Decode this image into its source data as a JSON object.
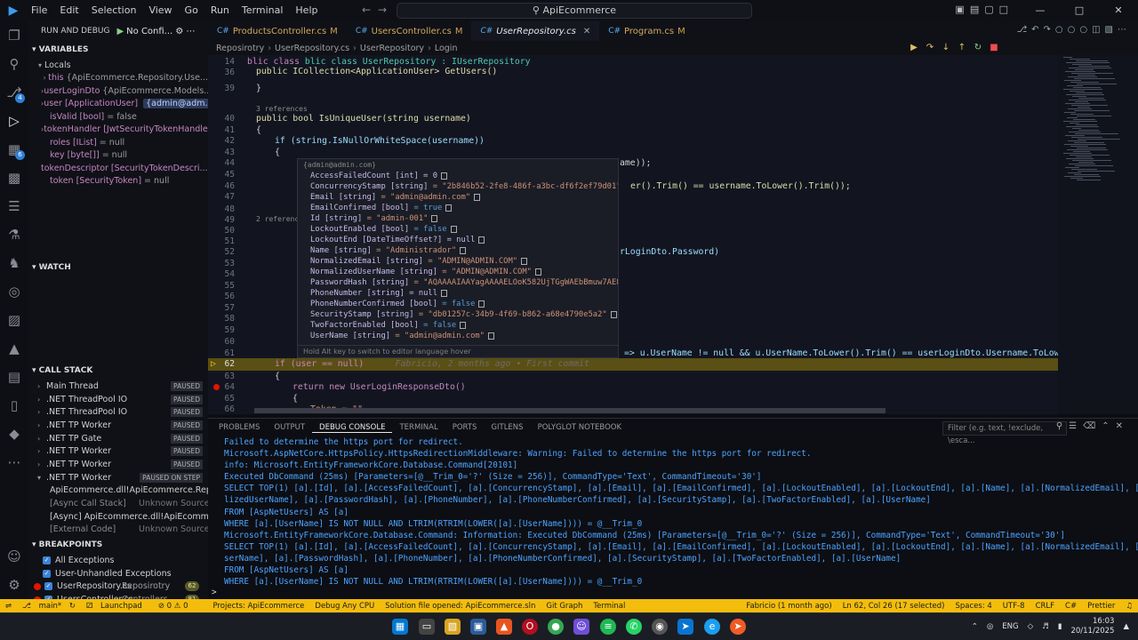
{
  "titlebar": {
    "menu": [
      "File",
      "Edit",
      "Selection",
      "View",
      "Go",
      "Run",
      "Terminal",
      "Help"
    ],
    "search": "ApiEcommerce"
  },
  "debug": {
    "header": "RUN AND DEBUG",
    "config": "No Confi...",
    "variables_title": "VARIABLES",
    "locals_title": "Locals",
    "locals": [
      {
        "name": "this",
        "value": "{ApiEcommerce.Repository.Use..."
      },
      {
        "name": "userLoginDto",
        "value": "{ApiEcommerce.Models..."
      },
      {
        "name": "user [ApplicationUser]",
        "value": "",
        "pill": "{admin@adm..."
      },
      {
        "name": "isValid [bool]",
        "value": "= false"
      },
      {
        "name": "tokenHandler [JwtSecurityTokenHandler...",
        "value": ""
      },
      {
        "name": "roles [IList]",
        "value": "= null"
      },
      {
        "name": "key [byte[]]",
        "value": "= null"
      },
      {
        "name": "tokenDescriptor [SecurityTokenDescri...",
        "value": ""
      },
      {
        "name": "token [SecurityToken]",
        "value": "= null"
      }
    ],
    "watch_title": "WATCH",
    "callstack_title": "CALL STACK",
    "callstack": [
      {
        "label": "Main Thread",
        "status": "PAUSED"
      },
      {
        "label": ".NET ThreadPool IO",
        "status": "PAUSED"
      },
      {
        "label": ".NET ThreadPool IO",
        "status": "PAUSED"
      },
      {
        "label": ".NET TP Worker",
        "status": "PAUSED"
      },
      {
        "label": ".NET TP Gate",
        "status": "PAUSED"
      },
      {
        "label": ".NET TP Worker",
        "status": "PAUSED"
      },
      {
        "label": ".NET TP Worker",
        "status": "PAUSED"
      },
      {
        "label": ".NET TP Worker",
        "status": "PAUSED ON STEP"
      }
    ],
    "frames": [
      {
        "label": "ApiEcommerce.dll!ApiEcommerce.Reposit...",
        "source": ""
      },
      {
        "label": "[Async Call Stack]",
        "source": "Unknown Source"
      },
      {
        "label": "[Async] ApiEcommerce.dll!ApiEcommerce...",
        "source": ""
      },
      {
        "label": "[External Code]",
        "source": "Unknown Source"
      }
    ],
    "breakpoints_title": "BREAKPOINTS",
    "breakpoints": [
      {
        "label": "All Exceptions",
        "folder": "",
        "count": ""
      },
      {
        "label": "User-Unhandled Exceptions",
        "folder": "",
        "count": ""
      },
      {
        "label": "UserRepository.cs",
        "folder": "Reposirotry",
        "count": "62"
      },
      {
        "label": "UsersController.cs",
        "folder": "Controllers",
        "count": "81"
      }
    ]
  },
  "tabs": [
    {
      "label": "ProductsController.cs",
      "mod": "M"
    },
    {
      "label": "UsersController.cs",
      "mod": "M"
    },
    {
      "label": "UserRepository.cs",
      "mod": ""
    },
    {
      "label": "Program.cs",
      "mod": "M"
    }
  ],
  "breadcrumb": [
    "Reposirotry",
    "UserRepository.cs",
    "UserRepository",
    "Login"
  ],
  "editor": {
    "line_numbers": [
      "14",
      "36",
      "39",
      "40",
      "41",
      "42",
      "43",
      "44",
      "45",
      "46",
      "47",
      "48",
      "49",
      "50",
      "51",
      "52",
      "53",
      "54",
      "55",
      "56",
      "57",
      "58",
      "59",
      "60",
      "61",
      "62",
      "63",
      "64",
      "65",
      "66"
    ],
    "code": {
      "l14": "blic class UserRepository : IUserRepository",
      "l36": "public ICollection<ApplicationUser> GetUsers()",
      "l39": "}",
      "refs1": "3 references",
      "l41": "public bool IsUniqueUser(string username)",
      "l42": "{",
      "l43": "if (string.IsNullOrWhiteSpace(username))",
      "l44": "{",
      "l45_tail": "ame));",
      "l47_tail": "er().Trim() == username.ToLower().Trim());",
      "refs2": "2 referenc",
      "l52_tail": "rLoginDto.Password)",
      "l61_tail": "=> u.UserName != null && u.UserName.ToLower().Trim() == userLoginDto.Username.ToLower().Trim());",
      "l62": "if (user == null)",
      "blame": "Fabricio, 2 months ago • First commit",
      "l63": "{",
      "l64": "return new UserLoginResponseDto()",
      "l65": "{",
      "l66": "Token = \"\","
    }
  },
  "hover": {
    "header": "{admin@admin.com}",
    "rows": [
      {
        "k": "AccessFailedCount [int]",
        "v": "= 0",
        "t": "num"
      },
      {
        "k": "ConcurrencyStamp [string]",
        "v": "= \"2b846b52-2fe8-486f-a3bc-df6f2ef79d01\"",
        "t": "str"
      },
      {
        "k": "Email [string]",
        "v": "= \"admin@admin.com\"",
        "t": "str"
      },
      {
        "k": "EmailConfirmed [bool]",
        "v": "= true",
        "t": "bool"
      },
      {
        "k": "Id [string]",
        "v": "= \"admin-001\"",
        "t": "str"
      },
      {
        "k": "LockoutEnabled [bool]",
        "v": "= false",
        "t": "bool"
      },
      {
        "k": "LockoutEnd [DateTimeOffset?]",
        "v": "= null",
        "t": "num"
      },
      {
        "k": "Name [string]",
        "v": "= \"Administrador\"",
        "t": "str"
      },
      {
        "k": "NormalizedEmail [string]",
        "v": "= \"ADMIN@ADMIN.COM\"",
        "t": "str"
      },
      {
        "k": "NormalizedUserName [string]",
        "v": "= \"ADMIN@ADMIN.COM\"",
        "t": "str"
      },
      {
        "k": "PasswordHash [string]",
        "v": "= \"AQAAAAIAAYagAAAAELOoK582UjTGgWAEbBmuw7AE84nREsIO",
        "t": "str"
      },
      {
        "k": "PhoneNumber [string]",
        "v": "= null",
        "t": "num"
      },
      {
        "k": "PhoneNumberConfirmed [bool]",
        "v": "= false",
        "t": "bool"
      },
      {
        "k": "SecurityStamp [string]",
        "v": "= \"db01257c-34b9-4f69-b862-a68e4790e5a2\"",
        "t": "str"
      },
      {
        "k": "TwoFactorEnabled [bool]",
        "v": "= false",
        "t": "bool"
      },
      {
        "k": "UserName [string]",
        "v": "= \"admin@admin.com\"",
        "t": "str"
      }
    ],
    "footer": "Hold Alt key to switch to editor language hover"
  },
  "panel": {
    "tabs": [
      "PROBLEMS",
      "OUTPUT",
      "DEBUG CONSOLE",
      "TERMINAL",
      "PORTS",
      "GITLENS",
      "POLYGLOT NOTEBOOK"
    ],
    "filter_placeholder": "Filter (e.g. text, !exclude, \\esca...",
    "console": [
      "      Failed to determine the https port for redirect.",
      "Microsoft.AspNetCore.HttpsPolicy.HttpsRedirectionMiddleware: Warning: Failed to determine the https port for redirect.",
      "info: Microsoft.EntityFrameworkCore.Database.Command[20101]",
      "      Executed DbCommand (25ms) [Parameters=[@__Trim_0='?' (Size = 256)], CommandType='Text', CommandTimeout='30']",
      "      SELECT TOP(1) [a].[Id], [a].[AccessFailedCount], [a].[ConcurrencyStamp], [a].[Email], [a].[EmailConfirmed], [a].[LockoutEnabled], [a].[LockoutEnd], [a].[Name], [a].[NormalizedEmail], [a].[Norma",
      "lizedUserName], [a].[PasswordHash], [a].[PhoneNumber], [a].[PhoneNumberConfirmed], [a].[SecurityStamp], [a].[TwoFactorEnabled], [a].[UserName]",
      "      FROM [AspNetUsers] AS [a]",
      "      WHERE [a].[UserName] IS NOT NULL AND LTRIM(RTRIM(LOWER([a].[UserName]))) = @__Trim_0",
      "Microsoft.EntityFrameworkCore.Database.Command: Information: Executed DbCommand (25ms) [Parameters=[@__Trim_0='?' (Size = 256)], CommandType='Text', CommandTimeout='30']",
      "SELECT TOP(1) [a].[Id], [a].[AccessFailedCount], [a].[ConcurrencyStamp], [a].[Email], [a].[EmailConfirmed], [a].[LockoutEnabled], [a].[LockoutEnd], [a].[Name], [a].[NormalizedEmail], [a].[NormalizedU",
      "serName], [a].[PasswordHash], [a].[PhoneNumber], [a].[PhoneNumberConfirmed], [a].[SecurityStamp], [a].[TwoFactorEnabled], [a].[UserName]",
      "FROM [AspNetUsers] AS [a]",
      "WHERE [a].[UserName] IS NOT NULL AND LTRIM(RTRIM(LOWER([a].[UserName]))) = @__Trim_0"
    ],
    "prompt": ">"
  },
  "status": {
    "branch": "main*",
    "launchpad": "Launchpad",
    "problems": "⊘ 0 ⚠ 0",
    "project": "Projects: ApiEcommerce",
    "debug": "Debug Any CPU",
    "solution": "Solution file opened: ApiEcommerce.sln",
    "gitgraph": "Git Graph",
    "terminal": "Terminal",
    "blame": "Fabricio (1 month ago)",
    "position": "Ln 62, Col 26 (17 selected)",
    "spaces": "Spaces: 4",
    "encoding": "UTF-8",
    "eol": "CRLF",
    "lang": "C#",
    "prettier": "Prettier"
  },
  "taskbar": {
    "lang": "ENG",
    "time": "16:03",
    "date": "20/11/2025"
  }
}
